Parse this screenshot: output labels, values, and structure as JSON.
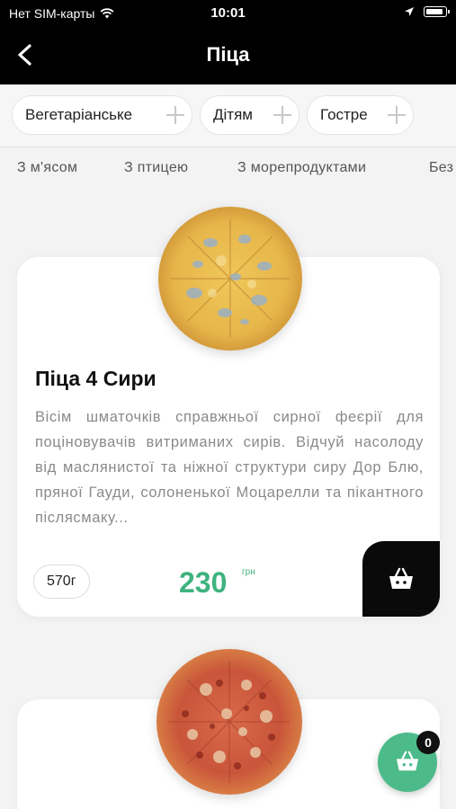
{
  "status_bar": {
    "carrier": "Нет SIM-карты",
    "time": "10:01"
  },
  "nav": {
    "title": "Піца",
    "back_icon": "chevron-left-icon"
  },
  "filters": [
    {
      "label": "Вегетаріанське"
    },
    {
      "label": "Дітям"
    },
    {
      "label": "Гостре"
    }
  ],
  "categories": [
    {
      "label": "З м'ясом"
    },
    {
      "label": "З птицею"
    },
    {
      "label": "З морепродуктами"
    },
    {
      "label": "Без"
    }
  ],
  "products": [
    {
      "name": "Піца 4 Сири",
      "description": "Вісім шматочків справжньої сирної феєрії для поціновувачів витриманих сирів. Відчуй насолоду від маслянистої та ніжної структури сиру Дор Блю, пряної Гауди, солоненької Моцарелли та пікантного післясмаку...",
      "weight": "570г",
      "price": "230",
      "currency": "грн"
    }
  ],
  "cart": {
    "count": "0"
  },
  "colors": {
    "accent": "#3fb37f",
    "header": "#000000",
    "background": "#f3f3f3"
  }
}
